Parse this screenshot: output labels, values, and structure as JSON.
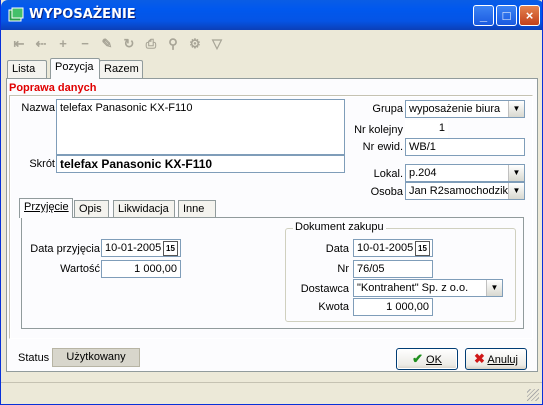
{
  "window": {
    "title": "WYPOSAŻENIE"
  },
  "toolbar": {
    "icons": [
      "first-icon",
      "prev-icon",
      "add-icon",
      "delete-icon",
      "edit-icon",
      "refresh-icon",
      "print-icon",
      "find-icon",
      "filter-options-icon",
      "filter-icon"
    ]
  },
  "tabs": {
    "lista": "Lista",
    "pozycja": "Pozycja",
    "razem": "Razem"
  },
  "section": {
    "title": "Poprawa danych"
  },
  "form": {
    "nazwa_label": "Nazwa",
    "nazwa_value": "telefax Panasonic KX-F110",
    "skrot_label": "Skrót",
    "skrot_value": "telefax Panasonic KX-F110",
    "grupa_label": "Grupa",
    "grupa_value": "wyposażenie biura",
    "nr_kolejny_label": "Nr kolejny",
    "nr_kolejny_value": "1",
    "nr_ewid_label": "Nr ewid.",
    "nr_ewid_value": "WB/1",
    "lokal_label": "Lokal.",
    "lokal_value": "p.204",
    "osoba_label": "Osoba",
    "osoba_value": "Jan R2samochodzik"
  },
  "subtabs": {
    "przyjecie": "Przyjęcie",
    "opis": "Opis",
    "likwidacja": "Likwidacja",
    "inne": "Inne"
  },
  "przyjecie": {
    "data_label": "Data przyjęcia",
    "data_value": "10-01-2005",
    "wartosc_label": "Wartość",
    "wartosc_value": "1 000,00"
  },
  "dokument": {
    "title": "Dokument zakupu",
    "data_label": "Data",
    "data_value": "10-01-2005",
    "nr_label": "Nr",
    "nr_value": "76/05",
    "dostawca_label": "Dostawca",
    "dostawca_value": "\"Kontrahent\" Sp. z o.o.",
    "kwota_label": "Kwota",
    "kwota_value": "1 000,00"
  },
  "calendar_icon_text": "15",
  "status": {
    "label": "Status",
    "value": "Użytkowany"
  },
  "buttons": {
    "ok": "OK",
    "cancel": "Anuluj"
  }
}
